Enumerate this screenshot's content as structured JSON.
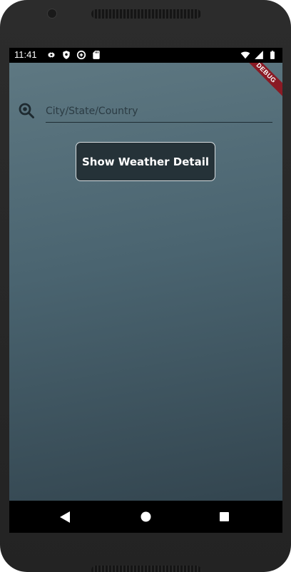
{
  "status_bar": {
    "time": "11:41",
    "left_icons": [
      "settings-icon",
      "shield-icon",
      "data-saver-icon",
      "sd-card-icon"
    ],
    "right_icons": [
      "wifi-icon",
      "signal-icon",
      "battery-icon"
    ]
  },
  "debug_banner": {
    "label": "DEBUG",
    "color": "#8a1a24"
  },
  "search": {
    "icon": "search-location-icon",
    "placeholder": "City/State/Country",
    "value": ""
  },
  "weather_button": {
    "label": "Show Weather Detail"
  },
  "nav_bar": {
    "items": [
      "back-icon",
      "home-icon",
      "recents-icon"
    ]
  },
  "colors": {
    "background_top": "#5e7882",
    "background_bottom": "#33454f",
    "button_bg": "#253238",
    "button_border": "#d7dde0"
  }
}
